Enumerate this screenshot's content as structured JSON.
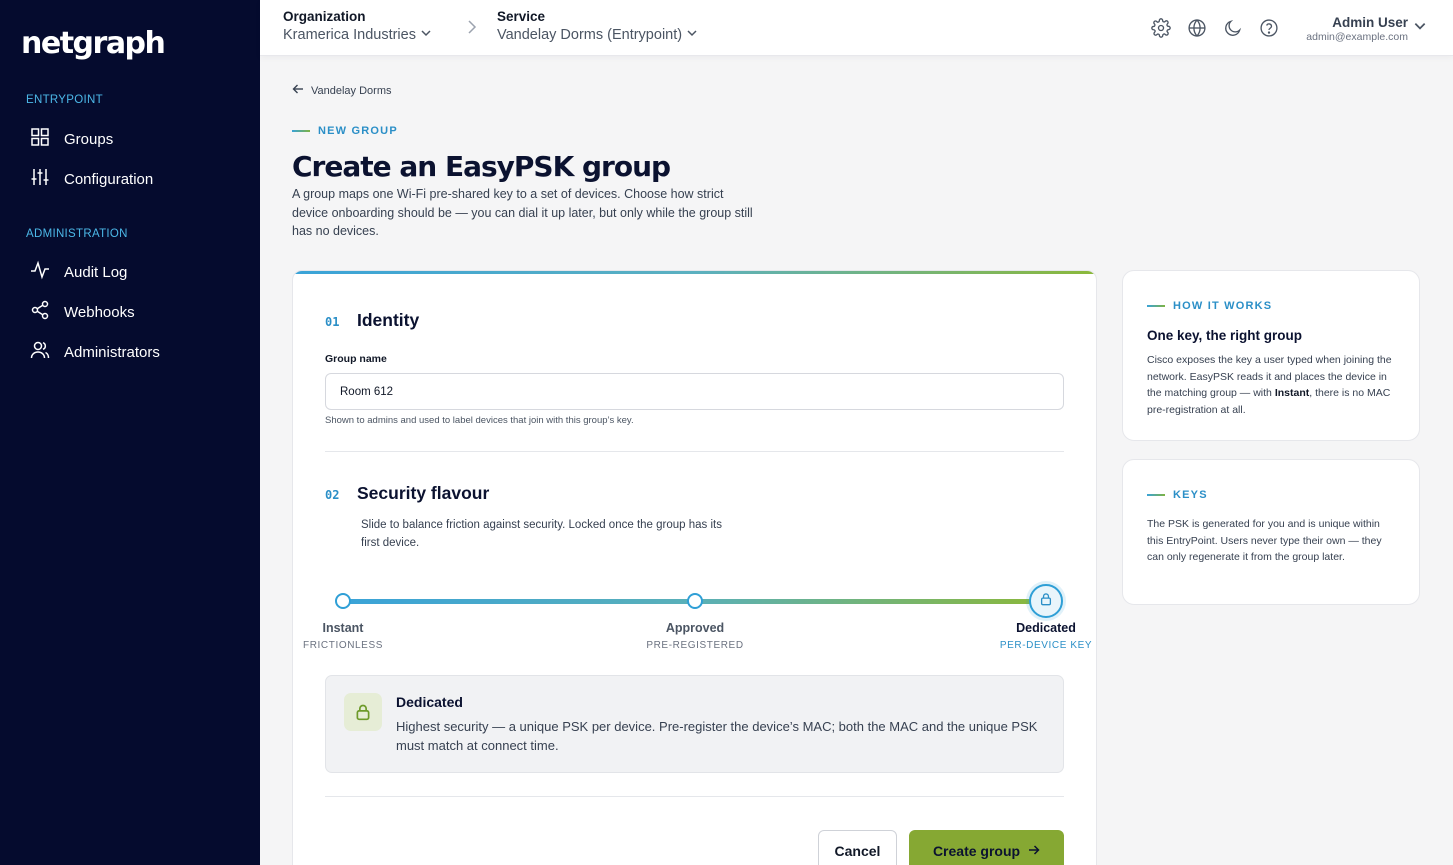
{
  "app": {
    "logo": "netgraph"
  },
  "sidebar": {
    "sections": [
      {
        "title": "ENTRYPOINT",
        "items": [
          {
            "label": "Groups",
            "icon": "grid-icon"
          },
          {
            "label": "Configuration",
            "icon": "sliders-icon"
          }
        ]
      },
      {
        "title": "ADMINISTRATION",
        "items": [
          {
            "label": "Audit Log",
            "icon": "activity-icon"
          },
          {
            "label": "Webhooks",
            "icon": "share-icon"
          },
          {
            "label": "Administrators",
            "icon": "users-icon"
          }
        ]
      }
    ]
  },
  "topbar": {
    "org_label": "Organization",
    "org_value": "Kramerica Industries",
    "service_label": "Service",
    "service_value": "Vandelay Dorms (Entrypoint)",
    "user_name": "Admin User",
    "user_email": "admin@example.com",
    "icons": [
      "gear-icon",
      "globe-icon",
      "moon-icon",
      "help-icon"
    ]
  },
  "page": {
    "back_label": "Vandelay Dorms",
    "eyebrow": "NEW GROUP",
    "title": "Create an EasyPSK group",
    "description": "A group maps one Wi-Fi pre-shared key to a set of devices. Choose how strict device onboarding should be — you can dial it up later, but only while the group still has no devices."
  },
  "form": {
    "step1": {
      "num": "01",
      "title": "Identity"
    },
    "group_name_label": "Group name",
    "group_name_value": "Room 612",
    "group_name_help": "Shown to admins and used to label devices that join with this group’s key.",
    "step2": {
      "num": "02",
      "title": "Security flavour"
    },
    "step2_desc": "Slide to balance friction against security. Locked once the group has its first device.",
    "levels": [
      {
        "name": "Instant",
        "sub": "FRICTIONLESS"
      },
      {
        "name": "Approved",
        "sub": "PRE-REGISTERED"
      },
      {
        "name": "Dedicated",
        "sub": "PER-DEVICE KEY"
      }
    ],
    "selected_level": 2,
    "info_title": "Dedicated",
    "info_text": "Highest security — a unique PSK per device. Pre-register the device’s MAC; both the MAC and the unique PSK must match at connect time.",
    "cancel_label": "Cancel",
    "create_label": "Create group"
  },
  "side": {
    "how": {
      "eyebrow": "HOW IT WORKS",
      "title": "One key, the right group",
      "text_a": "Cisco exposes the key a user typed when joining the network. EasyPSK reads it and places the device in the matching group — with ",
      "text_bold": "Instant",
      "text_b": ", there is no MAC pre-registration at all."
    },
    "keys": {
      "eyebrow": "KEYS",
      "text": "The PSK is generated for you and is unique within this EntryPoint. Users never type their own — they can only regenerate it from the group later."
    }
  },
  "colors": {
    "sidebar_bg": "#050b2e",
    "accent_blue": "#2b8fc7",
    "accent_green": "#86a833"
  }
}
